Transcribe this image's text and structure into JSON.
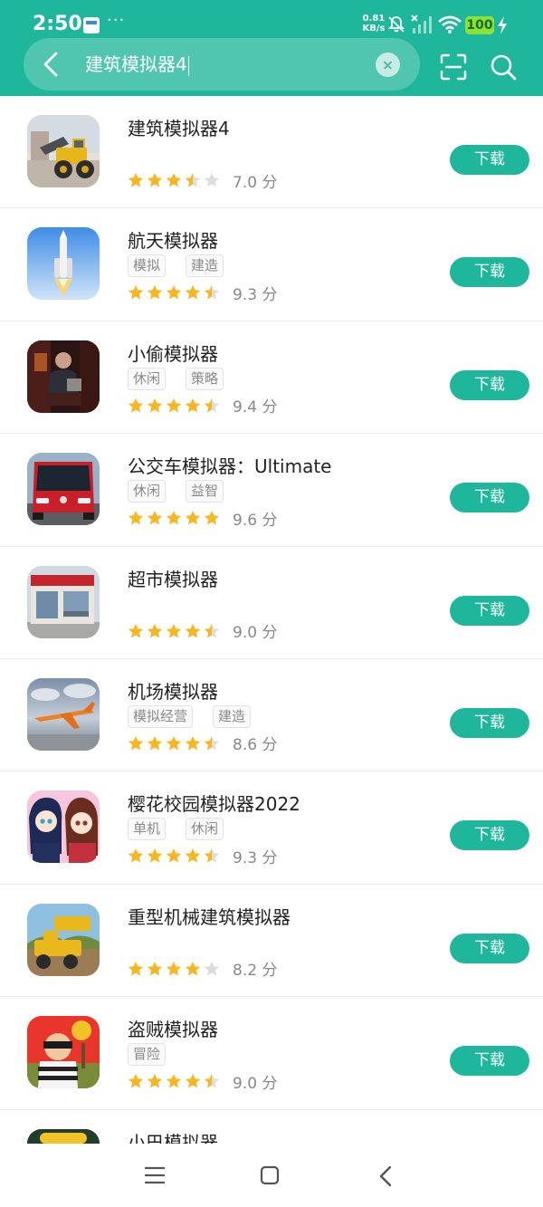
{
  "status_bar": {
    "time": "2:50",
    "more": "···",
    "net_speed_value": "0.81",
    "net_speed_unit": "KB/s",
    "battery": "100"
  },
  "search": {
    "query": "建筑模拟器4"
  },
  "download_label": "下载",
  "apps": [
    {
      "title": "建筑模拟器4",
      "tags": [],
      "rating": 3.5,
      "score": "7.0 分"
    },
    {
      "title": "航天模拟器",
      "tags": [
        "模拟",
        "建造"
      ],
      "rating": 4.5,
      "score": "9.3 分"
    },
    {
      "title": "小偷模拟器",
      "tags": [
        "休闲",
        "策略"
      ],
      "rating": 4.5,
      "score": "9.4 分"
    },
    {
      "title": "公交车模拟器：Ultimate",
      "tags": [
        "休闲",
        "益智"
      ],
      "rating": 5,
      "score": "9.6 分"
    },
    {
      "title": "超市模拟器",
      "tags": [],
      "rating": 4.5,
      "score": "9.0 分"
    },
    {
      "title": "机场模拟器",
      "tags": [
        "模拟经营",
        "建造"
      ],
      "rating": 4.5,
      "score": "8.6 分"
    },
    {
      "title": "樱花校园模拟器2022",
      "tags": [
        "单机",
        "休闲"
      ],
      "rating": 4.5,
      "score": "9.3 分"
    },
    {
      "title": "重型机械建筑模拟器",
      "tags": [],
      "rating": 4,
      "score": "8.2 分"
    },
    {
      "title": "盗贼模拟器",
      "tags": [
        "冒险"
      ],
      "rating": 4.5,
      "score": "9.0 分"
    },
    {
      "title": "小巴模拟器",
      "tags": [],
      "rating": null,
      "score": null
    }
  ],
  "colors": {
    "brand": "#1fb79c",
    "star": "#f9b620",
    "star_empty": "#dddddd"
  },
  "icons": {
    "back": "chevron-left-icon",
    "clear": "close-circle-icon",
    "scan": "scan-icon",
    "search": "search-icon",
    "nav_menu": "menu-icon",
    "nav_home": "home-square-icon",
    "nav_back": "chevron-left-icon"
  }
}
